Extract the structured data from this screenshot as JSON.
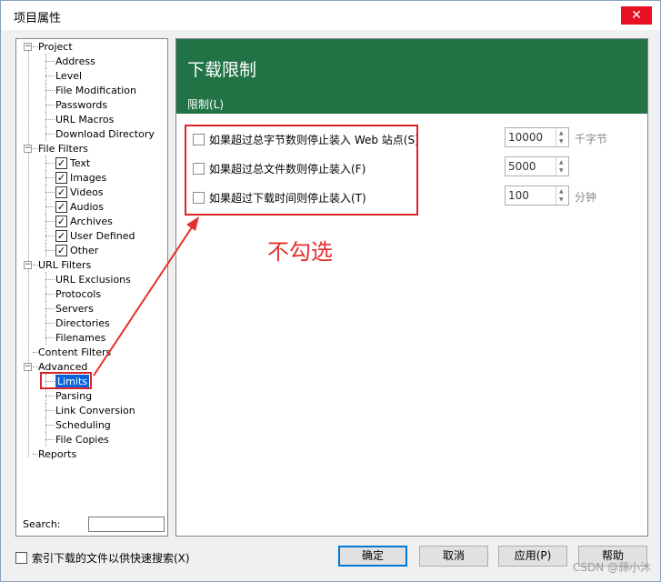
{
  "window": {
    "title": "项目属性",
    "close_glyph": "✕"
  },
  "tree": {
    "nodes": [
      {
        "label": "Project",
        "level": 0,
        "expander": "−"
      },
      {
        "label": "Address",
        "level": 1
      },
      {
        "label": "Level",
        "level": 1
      },
      {
        "label": "File Modification",
        "level": 1
      },
      {
        "label": "Passwords",
        "level": 1
      },
      {
        "label": "URL Macros",
        "level": 1
      },
      {
        "label": "Download Directory",
        "level": 1
      },
      {
        "label": "File Filters",
        "level": 0,
        "expander": "−"
      },
      {
        "label": "Text",
        "level": 1,
        "checked": true
      },
      {
        "label": "Images",
        "level": 1,
        "checked": true
      },
      {
        "label": "Videos",
        "level": 1,
        "checked": true
      },
      {
        "label": "Audios",
        "level": 1,
        "checked": true
      },
      {
        "label": "Archives",
        "level": 1,
        "checked": true
      },
      {
        "label": "User Defined",
        "level": 1,
        "checked": true
      },
      {
        "label": "Other",
        "level": 1,
        "checked": true
      },
      {
        "label": "URL Filters",
        "level": 0,
        "expander": "−"
      },
      {
        "label": "URL Exclusions",
        "level": 1
      },
      {
        "label": "Protocols",
        "level": 1
      },
      {
        "label": "Servers",
        "level": 1
      },
      {
        "label": "Directories",
        "level": 1
      },
      {
        "label": "Filenames",
        "level": 1
      },
      {
        "label": "Content Filters",
        "level": 0
      },
      {
        "label": "Advanced",
        "level": 0,
        "expander": "−"
      },
      {
        "label": "Limits",
        "level": 1,
        "selected": true
      },
      {
        "label": "Parsing",
        "level": 1
      },
      {
        "label": "Link Conversion",
        "level": 1
      },
      {
        "label": "Scheduling",
        "level": 1
      },
      {
        "label": "File Copies",
        "level": 1
      },
      {
        "label": "Reports",
        "level": 0
      }
    ],
    "check_glyph": "✓",
    "search_label": "Search:",
    "search_value": ""
  },
  "panel": {
    "header_title": "下载限制",
    "section_label": "限制(L)",
    "options": [
      {
        "label": "如果超过总字节数则停止装入 Web 站点(S)",
        "checked": false,
        "value": "10000",
        "unit": "千字节"
      },
      {
        "label": "如果超过总文件数则停止装入(F)",
        "checked": false,
        "value": "5000",
        "unit": ""
      },
      {
        "label": "如果超过下载时间则停止装入(T)",
        "checked": false,
        "value": "100",
        "unit": "分钟"
      }
    ],
    "spin_up": "▲",
    "spin_down": "▼"
  },
  "annotation": {
    "text": "不勾选",
    "color": "#e53030"
  },
  "footer": {
    "index_label": "索引下载的文件以供快速搜索(X)",
    "index_checked": false,
    "ok_label": "确定",
    "cancel_label": "取消",
    "apply_label": "应用(P)",
    "help_label": "帮助"
  },
  "watermark": "CSDN @蒜小沐",
  "colors": {
    "header_green": "#217346",
    "selection_blue": "#0a64d8",
    "highlight_red": "#d9252a",
    "close_red": "#e81123"
  }
}
